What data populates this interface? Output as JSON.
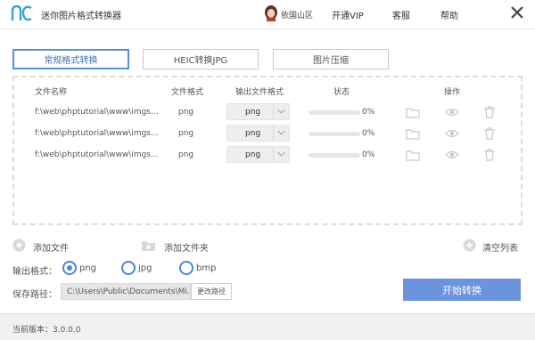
{
  "app": {
    "title": "迷你图片格式转换器",
    "user_name": "依国山区",
    "nav": {
      "vip": "开通VIP",
      "service": "客服",
      "help": "帮助"
    }
  },
  "tabs": [
    {
      "label": "常规格式转换",
      "active": true
    },
    {
      "label": "HEIC转换JPG",
      "active": false
    },
    {
      "label": "图片压缩",
      "active": false
    }
  ],
  "table": {
    "headers": {
      "name": "文件名称",
      "format": "文件格式",
      "output": "输出文件格式",
      "status": "状态",
      "actions": "操作"
    },
    "rows": [
      {
        "path": "f:\\web\\phptutorial\\www\\imgs...",
        "format": "png",
        "output": "png",
        "progress": "0%"
      },
      {
        "path": "f:\\web\\phptutorial\\www\\imgs...",
        "format": "png",
        "output": "png",
        "progress": "0%"
      },
      {
        "path": "f:\\web\\phptutorial\\www\\imgs...",
        "format": "png",
        "output": "png",
        "progress": "0%"
      }
    ]
  },
  "controls": {
    "add_file": "添加文件",
    "add_folder": "添加文件夹",
    "clear_list": "清空列表",
    "output_format_label": "输出格式：",
    "formats": [
      {
        "label": "png",
        "selected": true
      },
      {
        "label": "jpg",
        "selected": false
      },
      {
        "label": "bmp",
        "selected": false
      }
    ],
    "save_path_label": "保存路径：",
    "save_path": "C:\\Users\\Public\\Documents\\Mi...",
    "change_path": "更改路径",
    "start": "开始转换"
  },
  "status": {
    "version": "当前版本：3.0.0.0"
  },
  "colors": {
    "accent": "#6b94dc",
    "radio": "#4a86d9",
    "logo": "#3aa0d8"
  },
  "icons": [
    "logo-icon",
    "avatar-icon",
    "close-icon",
    "chevron-down-icon",
    "folder-icon",
    "eye-icon",
    "trash-icon",
    "plus-circle-icon",
    "add-folder-icon"
  ]
}
